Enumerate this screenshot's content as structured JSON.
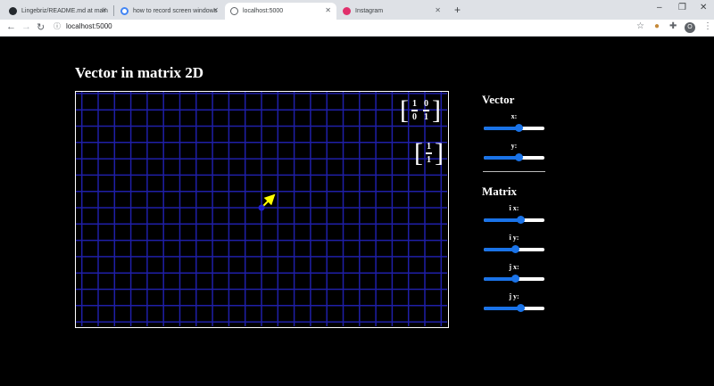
{
  "browser": {
    "tabs": [
      {
        "title": "Lingebriz/README.md at main",
        "icon": "github-icon"
      },
      {
        "title": "how to record screen windows",
        "icon": "google-icon"
      },
      {
        "title": "localhost:5000",
        "icon": "globe-icon"
      },
      {
        "title": "Instagram",
        "icon": "instagram-icon"
      }
    ],
    "url": "localhost:5000",
    "profile_initial": "O"
  },
  "page": {
    "title": "Vector in matrix 2D",
    "matrix": {
      "a": "1",
      "b": "0",
      "c": "0",
      "d": "1"
    },
    "vector": {
      "x": "1",
      "y": "1"
    }
  },
  "panel": {
    "vector_heading": "Vector",
    "matrix_heading": "Matrix",
    "controls": [
      {
        "label": "x:",
        "value": 0.58
      },
      {
        "label": "y:",
        "value": 0.58
      },
      {
        "label": "î x:",
        "value": 0.6
      },
      {
        "label": "î y:",
        "value": 0.52
      },
      {
        "label": "ĵ x:",
        "value": 0.52
      },
      {
        "label": "ĵ y:",
        "value": 0.6
      }
    ]
  },
  "colors": {
    "grid": "#1f1fa8",
    "vector": "#ffff00",
    "origin": "#1f1fcc",
    "slider": "#1a73e8"
  }
}
